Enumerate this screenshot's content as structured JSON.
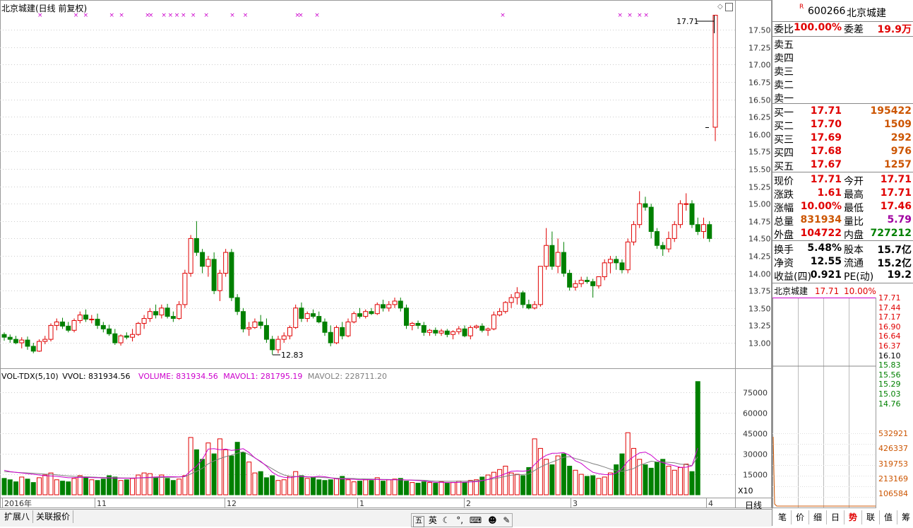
{
  "chart_title": "北京城建(日线 前复权)",
  "price_axis": [
    "17.50",
    "17.25",
    "17.00",
    "16.75",
    "16.50",
    "16.25",
    "16.00",
    "15.75",
    "15.50",
    "15.25",
    "15.00",
    "14.75",
    "14.50",
    "14.25",
    "14.00",
    "13.75",
    "13.50",
    "13.25",
    "13.00"
  ],
  "vol_axis": [
    "75000",
    "60000",
    "45000",
    "30000",
    "15000"
  ],
  "vol_unit": "X10",
  "high_label": "17.71",
  "low_label": "12.83",
  "vol_header": {
    "name": "VOL-TDX(5,10)",
    "vvol": "VVOL: 831934.56",
    "volume": "VOLUME: 831934.56",
    "mavol1": "MAVOL1: 281795.19",
    "mavol2": "MAVOL2: 228711.20"
  },
  "date_axis": {
    "year": "2016年",
    "labels": [
      "11",
      "12",
      "1",
      "2",
      "3",
      "4"
    ]
  },
  "period_label": "日线",
  "bottom_tabs": [
    "扩展八",
    "关联报价"
  ],
  "ime": {
    "wu": "五",
    "ying": "英"
  },
  "stock": {
    "code": "600266",
    "name": "北京城建",
    "badge": "R"
  },
  "weibi": {
    "label": "委比",
    "value": "100.00%",
    "label2": "委差",
    "value2": "19.9万"
  },
  "sell": [
    {
      "label": "卖五"
    },
    {
      "label": "卖四"
    },
    {
      "label": "卖三"
    },
    {
      "label": "卖二"
    },
    {
      "label": "卖一"
    }
  ],
  "buy": [
    {
      "label": "买一",
      "price": "17.71",
      "vol": "195422"
    },
    {
      "label": "买二",
      "price": "17.70",
      "vol": "1509"
    },
    {
      "label": "买三",
      "price": "17.69",
      "vol": "292"
    },
    {
      "label": "买四",
      "price": "17.68",
      "vol": "976"
    },
    {
      "label": "买五",
      "price": "17.67",
      "vol": "1257"
    }
  ],
  "quote": [
    {
      "l1": "现价",
      "v1": "17.71",
      "l2": "今开",
      "v2": "17.71",
      "c1": "red",
      "c2": "red"
    },
    {
      "l1": "涨跌",
      "v1": "1.61",
      "l2": "最高",
      "v2": "17.71",
      "c1": "red",
      "c2": "red"
    },
    {
      "l1": "涨幅",
      "v1": "10.00%",
      "l2": "最低",
      "v2": "17.46",
      "c1": "red",
      "c2": "red"
    },
    {
      "l1": "总量",
      "v1": "831934",
      "l2": "量比",
      "v2": "5.79",
      "c1": "orange",
      "c2": "purple"
    },
    {
      "l1": "外盘",
      "v1": "104722",
      "l2": "内盘",
      "v2": "727212",
      "c1": "red",
      "c2": "green"
    }
  ],
  "fund": [
    {
      "l1": "换手",
      "v1": "5.48%",
      "l2": "股本",
      "v2": "15.7亿"
    },
    {
      "l1": "净资",
      "v1": "12.55",
      "l2": "流通",
      "v2": "15.2亿"
    },
    {
      "l1": "收益(四)",
      "v1": "0.921",
      "l2": "PE(动)",
      "v2": "19.2"
    }
  ],
  "mini": {
    "name": "北京城建",
    "price": "17.71",
    "pct": "10.00%",
    "prices": [
      "17.71",
      "17.44",
      "17.17",
      "16.90",
      "16.64",
      "16.37",
      "16.10",
      "15.83",
      "15.56",
      "15.29",
      "15.03",
      "14.76"
    ],
    "vols": [
      "532921",
      "426337",
      "319753",
      "213169",
      "106584"
    ]
  },
  "right_tabs": [
    "笔",
    "价",
    "细",
    "日",
    "势",
    "联",
    "值",
    "筹"
  ],
  "colors": {
    "up": "#e00000",
    "down": "#008000",
    "ma1": "#cc00cc",
    "ma2": "#808080"
  },
  "chart_data": {
    "type": "candlestick",
    "title": "北京城建(日线 前复权)",
    "ylim": [
      12.6,
      17.9
    ],
    "ohlc": [
      [
        13.12,
        13.15,
        13.03,
        13.08
      ],
      [
        13.08,
        13.12,
        13.0,
        13.05
      ],
      [
        13.05,
        13.1,
        12.98,
        13.0
      ],
      [
        13.0,
        13.08,
        12.92,
        13.04
      ],
      [
        13.04,
        13.09,
        12.9,
        12.95
      ],
      [
        12.95,
        13.0,
        12.85,
        12.88
      ],
      [
        12.88,
        13.05,
        12.87,
        13.02
      ],
      [
        13.02,
        13.1,
        12.98,
        13.05
      ],
      [
        13.05,
        13.28,
        13.02,
        13.25
      ],
      [
        13.25,
        13.35,
        13.18,
        13.3
      ],
      [
        13.3,
        13.36,
        13.2,
        13.24
      ],
      [
        13.24,
        13.3,
        13.15,
        13.18
      ],
      [
        13.18,
        13.35,
        13.15,
        13.32
      ],
      [
        13.32,
        13.45,
        13.28,
        13.4
      ],
      [
        13.4,
        13.48,
        13.3,
        13.34
      ],
      [
        13.34,
        13.4,
        13.28,
        13.34
      ],
      [
        13.34,
        13.42,
        13.2,
        13.25
      ],
      [
        13.25,
        13.3,
        13.15,
        13.2
      ],
      [
        13.2,
        13.26,
        13.1,
        13.13
      ],
      [
        13.13,
        13.2,
        12.97,
        13.0
      ],
      [
        13.0,
        13.12,
        12.96,
        13.1
      ],
      [
        13.1,
        13.15,
        13.05,
        13.08
      ],
      [
        13.08,
        13.2,
        13.02,
        13.12
      ],
      [
        13.12,
        13.3,
        13.1,
        13.28
      ],
      [
        13.28,
        13.4,
        13.2,
        13.35
      ],
      [
        13.35,
        13.5,
        13.3,
        13.45
      ],
      [
        13.45,
        13.55,
        13.35,
        13.4
      ],
      [
        13.4,
        13.55,
        13.35,
        13.5
      ],
      [
        13.5,
        13.56,
        13.35,
        13.38
      ],
      [
        13.38,
        13.45,
        13.3,
        13.35
      ],
      [
        13.35,
        13.6,
        13.33,
        13.55
      ],
      [
        13.55,
        14.05,
        13.5,
        14.0
      ],
      [
        14.0,
        14.55,
        13.95,
        14.5
      ],
      [
        14.5,
        14.75,
        14.25,
        14.3
      ],
      [
        14.3,
        14.35,
        14.0,
        14.1
      ],
      [
        14.1,
        14.25,
        13.95,
        14.2
      ],
      [
        14.2,
        14.3,
        13.7,
        13.75
      ],
      [
        13.75,
        14.05,
        13.6,
        14.0
      ],
      [
        14.0,
        14.35,
        13.95,
        14.3
      ],
      [
        14.3,
        14.35,
        13.6,
        13.65
      ],
      [
        13.65,
        13.7,
        13.4,
        13.45
      ],
      [
        13.45,
        13.5,
        13.15,
        13.2
      ],
      [
        13.2,
        13.3,
        13.1,
        13.22
      ],
      [
        13.22,
        13.35,
        13.2,
        13.3
      ],
      [
        13.3,
        13.4,
        13.2,
        13.25
      ],
      [
        13.25,
        13.35,
        13.0,
        13.05
      ],
      [
        13.05,
        13.1,
        12.83,
        12.9
      ],
      [
        12.9,
        13.1,
        12.85,
        13.05
      ],
      [
        13.05,
        13.15,
        13.0,
        13.1
      ],
      [
        13.1,
        13.25,
        13.05,
        13.22
      ],
      [
        13.22,
        13.55,
        13.2,
        13.5
      ],
      [
        13.5,
        13.58,
        13.3,
        13.35
      ],
      [
        13.35,
        13.45,
        13.3,
        13.42
      ],
      [
        13.42,
        13.48,
        13.35,
        13.38
      ],
      [
        13.38,
        13.45,
        13.28,
        13.3
      ],
      [
        13.3,
        13.35,
        13.1,
        13.15
      ],
      [
        13.15,
        13.25,
        12.95,
        13.0
      ],
      [
        13.0,
        13.25,
        12.98,
        13.22
      ],
      [
        13.22,
        13.3,
        13.05,
        13.1
      ],
      [
        13.1,
        13.35,
        13.08,
        13.3
      ],
      [
        13.3,
        13.45,
        13.28,
        13.42
      ],
      [
        13.42,
        13.5,
        13.35,
        13.38
      ],
      [
        13.38,
        13.48,
        13.35,
        13.45
      ],
      [
        13.45,
        13.5,
        13.4,
        13.42
      ],
      [
        13.42,
        13.58,
        13.4,
        13.55
      ],
      [
        13.55,
        13.62,
        13.45,
        13.5
      ],
      [
        13.5,
        13.6,
        13.45,
        13.55
      ],
      [
        13.55,
        13.65,
        13.5,
        13.6
      ],
      [
        13.6,
        13.65,
        13.45,
        13.5
      ],
      [
        13.5,
        13.55,
        13.2,
        13.25
      ],
      [
        13.25,
        13.3,
        13.18,
        13.28
      ],
      [
        13.28,
        13.32,
        13.2,
        13.25
      ],
      [
        13.25,
        13.3,
        13.1,
        13.15
      ],
      [
        13.15,
        13.2,
        13.1,
        13.18
      ],
      [
        13.18,
        13.22,
        13.1,
        13.14
      ],
      [
        13.14,
        13.2,
        13.1,
        13.17
      ],
      [
        13.17,
        13.2,
        13.08,
        13.12
      ],
      [
        13.12,
        13.18,
        13.05,
        13.16
      ],
      [
        13.16,
        13.24,
        13.12,
        13.2
      ],
      [
        13.2,
        13.25,
        13.08,
        13.1
      ],
      [
        13.1,
        13.25,
        13.05,
        13.22
      ],
      [
        13.22,
        13.26,
        13.2,
        13.24
      ],
      [
        13.24,
        13.28,
        13.15,
        13.18
      ],
      [
        13.18,
        13.22,
        13.1,
        13.2
      ],
      [
        13.2,
        13.45,
        13.18,
        13.4
      ],
      [
        13.4,
        13.5,
        13.38,
        13.45
      ],
      [
        13.45,
        13.6,
        13.42,
        13.58
      ],
      [
        13.58,
        13.7,
        13.5,
        13.65
      ],
      [
        13.65,
        13.8,
        13.55,
        13.72
      ],
      [
        13.72,
        13.75,
        13.5,
        13.55
      ],
      [
        13.55,
        13.62,
        13.48,
        13.5
      ],
      [
        13.5,
        13.6,
        13.48,
        13.55
      ],
      [
        13.55,
        14.1,
        13.52,
        14.1
      ],
      [
        14.1,
        14.65,
        14.05,
        14.4
      ],
      [
        14.4,
        14.6,
        14.05,
        14.1
      ],
      [
        14.1,
        14.5,
        14.0,
        14.3
      ],
      [
        14.3,
        14.45,
        13.95,
        14.0
      ],
      [
        14.0,
        14.05,
        13.75,
        13.8
      ],
      [
        13.8,
        13.9,
        13.75,
        13.85
      ],
      [
        13.85,
        13.95,
        13.8,
        13.9
      ],
      [
        13.9,
        13.95,
        13.85,
        13.88
      ],
      [
        13.88,
        13.92,
        13.65,
        13.82
      ],
      [
        13.82,
        13.95,
        13.78,
        13.95
      ],
      [
        13.95,
        14.2,
        13.9,
        14.15
      ],
      [
        14.15,
        14.25,
        14.0,
        14.2
      ],
      [
        14.2,
        14.25,
        14.05,
        14.15
      ],
      [
        14.15,
        14.2,
        14.0,
        14.05
      ],
      [
        14.05,
        14.5,
        14.0,
        14.45
      ],
      [
        14.45,
        14.75,
        14.4,
        14.7
      ],
      [
        14.7,
        15.18,
        14.65,
        15.0
      ],
      [
        15.0,
        15.1,
        14.9,
        14.95
      ],
      [
        14.95,
        15.0,
        14.5,
        14.6
      ],
      [
        14.6,
        14.65,
        14.35,
        14.4
      ],
      [
        14.4,
        14.45,
        14.25,
        14.35
      ],
      [
        14.35,
        14.6,
        14.3,
        14.5
      ],
      [
        14.5,
        14.75,
        14.45,
        14.7
      ],
      [
        14.7,
        15.05,
        14.65,
        15.0
      ],
      [
        15.0,
        15.15,
        14.9,
        15.0
      ],
      [
        15.0,
        15.05,
        14.65,
        14.7
      ],
      [
        14.7,
        14.8,
        14.55,
        14.6
      ],
      [
        14.6,
        14.8,
        14.5,
        14.7
      ],
      [
        14.7,
        14.75,
        14.45,
        14.5
      ],
      [
        16.1,
        17.71,
        15.9,
        17.71
      ]
    ],
    "volume": [
      12000,
      11000,
      9500,
      13000,
      11500,
      9000,
      12500,
      14500,
      16000,
      11000,
      10000,
      9500,
      12000,
      14000,
      12500,
      11000,
      10500,
      11500,
      14000,
      13000,
      10500,
      11000,
      12000,
      14500,
      16000,
      15500,
      13000,
      14500,
      12000,
      10500,
      11500,
      14000,
      42000,
      33000,
      26000,
      38000,
      30000,
      41000,
      33000,
      28500,
      38500,
      31000,
      24000,
      16000,
      17000,
      12500,
      14000,
      10500,
      11000,
      13500,
      17000,
      14000,
      12000,
      13000,
      11000,
      10500,
      11000,
      12000,
      13500,
      11000,
      9500,
      10000,
      11000,
      10500,
      12500,
      10000,
      11000,
      11500,
      12000,
      10000,
      9000,
      8500,
      9500,
      9000,
      8500,
      9500,
      8500,
      9000,
      10000,
      9000,
      10500,
      11000,
      13000,
      14500,
      16500,
      18500,
      21000,
      16000,
      15000,
      14000,
      20000,
      41000,
      34000,
      26000,
      22000,
      28500,
      30000,
      21000,
      18000,
      15000,
      13500,
      14000,
      12000,
      13000,
      16000,
      22000,
      30000,
      45500,
      34000,
      26000,
      22000,
      19500,
      24000,
      26000,
      21000,
      18000,
      20000,
      22500,
      17000,
      83000
    ],
    "mavol1": [
      18000,
      17000,
      16500,
      16000,
      15500,
      15000,
      14500,
      14000,
      13800,
      13500,
      13000,
      12500,
      12600,
      12800,
      12700,
      12600,
      12500,
      12400,
      12300,
      12200,
      12200,
      12100,
      12200,
      12400,
      12600,
      12800,
      13000,
      13200,
      13300,
      13200,
      13100,
      13600,
      17500,
      21000,
      26000,
      33500,
      33800,
      33000,
      33500,
      32500,
      33000,
      33800,
      31000,
      27000,
      24500,
      21000,
      16500,
      14000,
      12800,
      12500,
      13200,
      13500,
      13200,
      13000,
      13600,
      13200,
      12500,
      11600,
      11500,
      11500,
      11400,
      11100,
      11100,
      11200,
      11200,
      11000,
      11000,
      11000,
      11000,
      10900,
      10800,
      10400,
      10200,
      9600,
      9100,
      9100,
      8900,
      9000,
      9100,
      9200,
      9400,
      9600,
      10300,
      11200,
      12700,
      13800,
      15500,
      17200,
      17500,
      17300,
      17700,
      22200,
      26300,
      28900,
      30400,
      30500,
      30900,
      29000,
      24900,
      23000,
      19500,
      16500,
      15500,
      14800,
      14700,
      15900,
      19100,
      24600,
      28000,
      30700,
      31300,
      29000,
      25300,
      23500,
      22300,
      21300,
      20100,
      20200,
      21300,
      34300
    ],
    "mavol2": [
      17000,
      16800,
      16500,
      16200,
      16000,
      15800,
      15500,
      15200,
      15000,
      14600,
      14200,
      13800,
      13500,
      13400,
      13200,
      13000,
      12800,
      12700,
      12600,
      12500,
      12400,
      12300,
      12300,
      12350,
      12400,
      12500,
      12600,
      12700,
      12800,
      12900,
      13000,
      13300,
      15300,
      17200,
      19400,
      22700,
      24800,
      26500,
      28000,
      29000,
      30500,
      31500,
      29500,
      27200,
      24000,
      21500,
      19000,
      16500,
      14500,
      13600,
      13400,
      13200,
      13000,
      12900,
      12800,
      12600,
      12400,
      12200,
      12100,
      12000,
      11900,
      11700,
      11600,
      11500,
      11400,
      11300,
      11200,
      11100,
      11000,
      10900,
      10800,
      10700,
      10600,
      10300,
      10000,
      10000,
      9900,
      9900,
      10000,
      10000,
      10100,
      10200,
      10600,
      11200,
      11800,
      12600,
      13500,
      14400,
      14700,
      14800,
      15300,
      17800,
      20300,
      22300,
      24000,
      25600,
      27500,
      28000,
      26600,
      25400,
      24200,
      22800,
      21700,
      20300,
      18800,
      17600,
      17200,
      18100,
      19300,
      21600,
      23100,
      24600,
      24100,
      24000,
      23800,
      23400,
      22500,
      22100,
      21400,
      27900
    ],
    "markers": [
      11,
      22,
      25,
      33,
      36,
      44,
      45,
      49,
      51,
      53,
      55,
      58,
      62,
      70,
      74,
      90,
      91,
      96,
      153,
      189,
      192,
      195,
      197
    ]
  }
}
